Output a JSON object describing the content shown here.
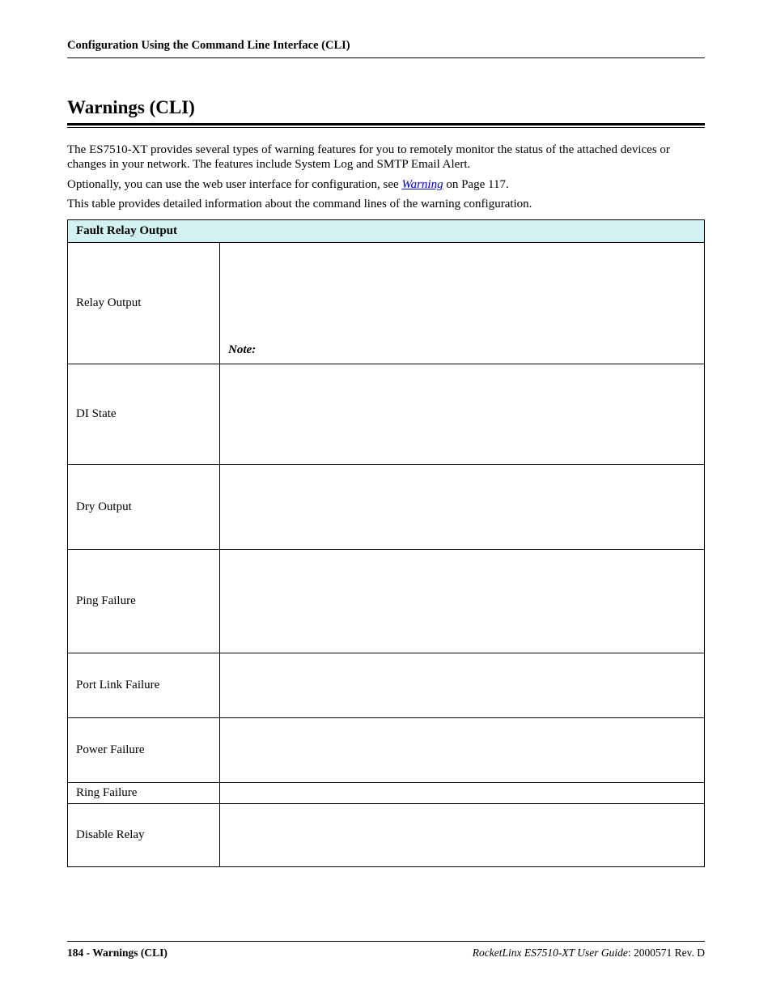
{
  "header": {
    "running": "Configuration Using the Command Line Interface (CLI)"
  },
  "section": {
    "title": "Warnings (CLI)"
  },
  "paragraphs": {
    "p1": "The ES7510-XT provides several types of warning features for you to remotely monitor the status of the attached devices or changes in your network. The features include System Log and SMTP Email Alert.",
    "p2a": "Optionally, you can use the web user interface for configuration, see ",
    "p2link": "Warning",
    "p2b": " on Page 117.",
    "p3": "This table provides detailed information about the command lines of the warning configuration."
  },
  "table": {
    "header": "Fault Relay Output",
    "rows": {
      "relay_output": "Relay Output",
      "note_label": "Note:",
      "di_state": "DI State",
      "dry_output": "Dry Output",
      "ping_failure": "Ping Failure",
      "port_link_failure": "Port Link Failure",
      "power_failure": "Power Failure",
      "ring_failure": "Ring Failure",
      "disable_relay": "Disable Relay"
    }
  },
  "footer": {
    "left": "184 - Warnings (CLI)",
    "right_ital": "RocketLinx ES7510-XT  User Guide",
    "right_plain": ": 2000571 Rev. D"
  }
}
